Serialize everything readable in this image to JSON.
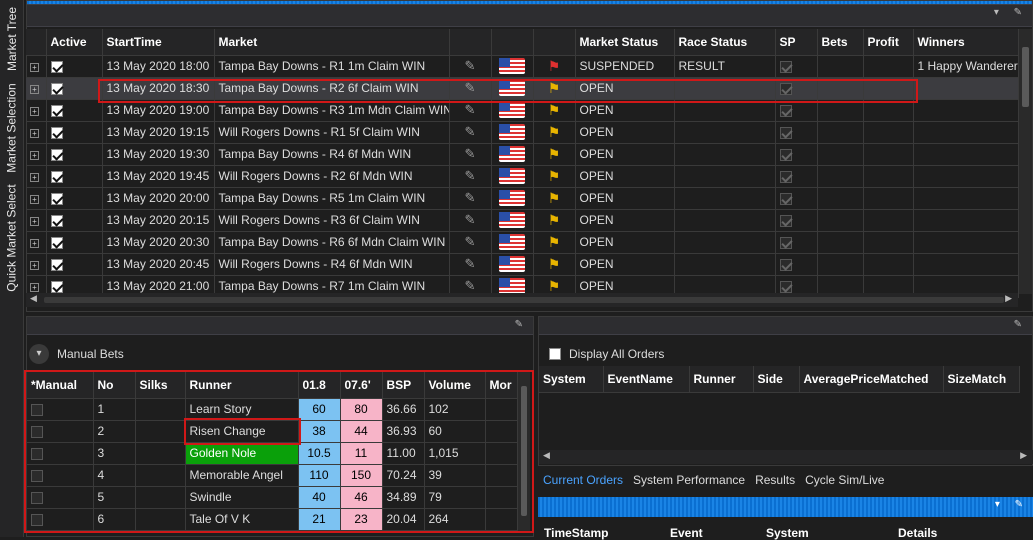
{
  "sidebar": {
    "tabs": [
      "Market Tree",
      "Market Selection",
      "Quick Market Select"
    ]
  },
  "markets": {
    "columns": [
      "Active",
      "StartTime",
      "Market",
      "",
      "",
      "",
      "Market Status",
      "Race Status",
      "SP",
      "Bets",
      "Profit",
      "Winners"
    ],
    "rows": [
      {
        "time": "13 May 2020 18:00",
        "market": "Tampa Bay Downs - R1 1m Claim WIN",
        "status": "SUSPENDED",
        "race": "RESULT",
        "winners": "1 Happy Wanderer",
        "flag": "red"
      },
      {
        "time": "13 May 2020 18:30",
        "market": "Tampa Bay Downs - R2 6f Claim WIN",
        "status": "OPEN",
        "race": "",
        "winners": "",
        "flag": "yellow"
      },
      {
        "time": "13 May 2020 19:00",
        "market": "Tampa Bay Downs - R3 1m Mdn Claim WIN",
        "status": "OPEN",
        "race": "",
        "winners": "",
        "flag": "yellow"
      },
      {
        "time": "13 May 2020 19:15",
        "market": "Will Rogers Downs - R1 5f Claim WIN",
        "status": "OPEN",
        "race": "",
        "winners": "",
        "flag": "yellow"
      },
      {
        "time": "13 May 2020 19:30",
        "market": "Tampa Bay Downs - R4 6f Mdn WIN",
        "status": "OPEN",
        "race": "",
        "winners": "",
        "flag": "yellow"
      },
      {
        "time": "13 May 2020 19:45",
        "market": "Will Rogers Downs - R2 6f Mdn WIN",
        "status": "OPEN",
        "race": "",
        "winners": "",
        "flag": "yellow"
      },
      {
        "time": "13 May 2020 20:00",
        "market": "Tampa Bay Downs - R5 1m Claim WIN",
        "status": "OPEN",
        "race": "",
        "winners": "",
        "flag": "yellow"
      },
      {
        "time": "13 May 2020 20:15",
        "market": "Will Rogers Downs - R3 6f Claim WIN",
        "status": "OPEN",
        "race": "",
        "winners": "",
        "flag": "yellow"
      },
      {
        "time": "13 May 2020 20:30",
        "market": "Tampa Bay Downs - R6 6f Mdn Claim WIN",
        "status": "OPEN",
        "race": "",
        "winners": "",
        "flag": "yellow"
      },
      {
        "time": "13 May 2020 20:45",
        "market": "Will Rogers Downs - R4 6f Mdn WIN",
        "status": "OPEN",
        "race": "",
        "winners": "",
        "flag": "yellow"
      },
      {
        "time": "13 May 2020 21:00",
        "market": "Tampa Bay Downs - R7 1m Claim WIN",
        "status": "OPEN",
        "race": "",
        "winners": "",
        "flag": "yellow"
      }
    ]
  },
  "manual": {
    "title": "Manual Bets",
    "columns": [
      "*Manual",
      "No",
      "Silks",
      "Runner",
      "01.8",
      "07.6'",
      "BSP",
      "Volume",
      "Mor"
    ],
    "rows": [
      {
        "no": "1",
        "runner": "Learn Story",
        "back": "60",
        "lay": "80",
        "bsp": "36.66",
        "vol": "102",
        "green": false
      },
      {
        "no": "2",
        "runner": "Risen Change",
        "back": "38",
        "lay": "44",
        "bsp": "36.93",
        "vol": "60",
        "green": false
      },
      {
        "no": "3",
        "runner": "Golden Nole",
        "back": "10.5",
        "lay": "11",
        "bsp": "11.00",
        "vol": "1,015",
        "green": true
      },
      {
        "no": "4",
        "runner": "Memorable Angel",
        "back": "110",
        "lay": "150",
        "bsp": "70.24",
        "vol": "39",
        "green": false
      },
      {
        "no": "5",
        "runner": "Swindle",
        "back": "40",
        "lay": "46",
        "bsp": "34.89",
        "vol": "79",
        "green": false
      },
      {
        "no": "6",
        "runner": "Tale Of V K",
        "back": "21",
        "lay": "23",
        "bsp": "20.04",
        "vol": "264",
        "green": false
      }
    ]
  },
  "orders": {
    "display_all": "Display All Orders",
    "columns": [
      "System",
      "EventName",
      "Runner",
      "Side",
      "AveragePriceMatched",
      "SizeMatch"
    ],
    "tabs": [
      "Current Orders",
      "System Performance",
      "Results",
      "Cycle Sim/Live"
    ],
    "bottom_columns": [
      "TimeStamp",
      "Event",
      "System",
      "Details"
    ]
  },
  "colors": {
    "accent": "#1a84e5",
    "back": "#7cc2f2",
    "lay": "#f7b4c8",
    "highlight": "#d01818"
  }
}
